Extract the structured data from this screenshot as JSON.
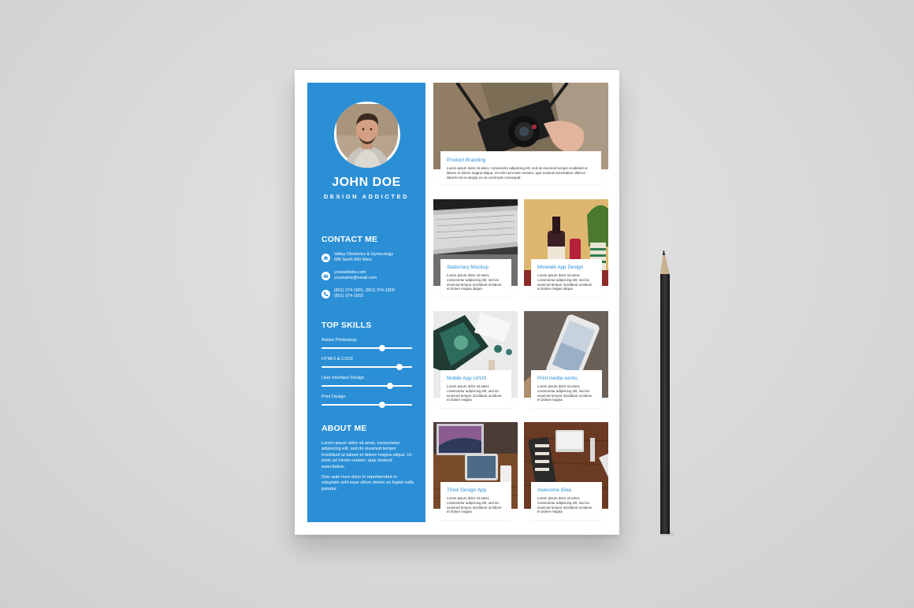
{
  "profile": {
    "name": "JOHN DOE",
    "tagline": "DESIGN ADDICTED"
  },
  "contact": {
    "title": "CONTACT ME",
    "items": [
      {
        "icon": "home-icon",
        "lines": [
          "Valley Obstetrics & Gynecology",
          "585 North 500 West"
        ]
      },
      {
        "icon": "mail-icon",
        "lines": [
          "yourwebsite.com",
          "yourname@email.com"
        ]
      },
      {
        "icon": "phone-icon",
        "lines": [
          "(801) 374-1801, (801) 374-1800",
          "(801) 374-1803"
        ]
      }
    ]
  },
  "skills": {
    "title": "TOP SKILLS",
    "items": [
      {
        "label": "Adobe Photoshop",
        "level": 0.67
      },
      {
        "label": "HTML5 & CSS3",
        "level": 0.86
      },
      {
        "label": "User Interface Design",
        "level": 0.76
      },
      {
        "label": "Print Design",
        "level": 0.67
      }
    ]
  },
  "about": {
    "title": "ABOUT ME",
    "paragraphs": [
      "Lorem ipsum dolor sit amet, consectetur adipiscing elit, sed do eiusmod tempor incididunt ut labore et dolore magna aliqua.  Ut enim ad minim veniam, quis nostrud exercitation.",
      "Duis aute irure dolor in reprehendert in voluptate velit esse cillum dolore eu fugiat nulla pariatur."
    ]
  },
  "portfolio": {
    "featured": {
      "title": "Product Branding",
      "text": "Lorem ipsum dolor sit amet, consectetur adipiscing elit, sed do eiusmod tempor incididunt ut labore et dolore magna aliqua. Ut enim ad minim veniam, quis nostrud exercitation ullamco laboris nisi ut aliquip ex ea commodo consequat."
    },
    "items": [
      {
        "title": "Stationary Mockup",
        "text": "Lorem ipsum dolor sit amet, consectetur adipiscing elit, sed do eiusmod tempor incididunt ut labore et dolore magna aliqua"
      },
      {
        "title": "Minetalk App Design",
        "text": "Lorem ipsum dolor sit amet, consectetur adipiscing elit, sed do eiusmod tempor incididunt ut labore et dolore magna aliqua"
      },
      {
        "title": "Mobile App UI/UX",
        "text": "Lorem ipsum dolor sit amet, consectetur adipiscing elit, sed do eiusmod tempor incididunt ut labore et dolore magna"
      },
      {
        "title": "Print media works",
        "text": "Lorem ipsum dolor sit amet, consectetur adipiscing elit, sed do eiusmod tempor incididunt ut labore et dolore magna"
      },
      {
        "title": "Think Design App",
        "text": "Lorem ipsum dolor sit amet, consectetur adipiscing elit, sed do eiusmod tempor incididunt ut labore et dolore magna"
      },
      {
        "title": "Awesome iDea",
        "text": "Lorem ipsum dolor sit amet, consectetur adipiscing elit, sed do eiusmod tempor incididunt ut labore et dolore magna"
      }
    ]
  },
  "colors": {
    "accent": "#2b8fd6",
    "background": "#d9d9db"
  }
}
